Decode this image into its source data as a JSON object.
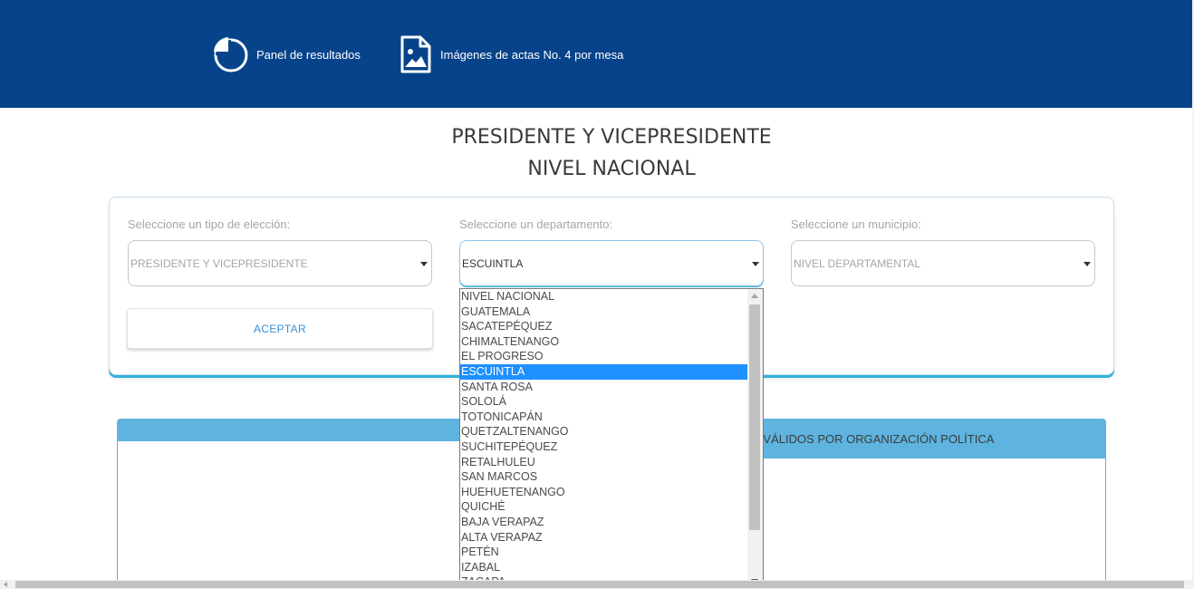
{
  "header": {
    "nav": [
      {
        "label": "Panel de resultados",
        "icon": "pie-chart-icon"
      },
      {
        "label": "Imágenes de actas No. 4 por mesa",
        "icon": "image-file-icon"
      }
    ],
    "background": "#06438a"
  },
  "titles": {
    "line1": "PRESIDENTE Y VICEPRESIDENTE",
    "line2": "NIVEL NACIONAL"
  },
  "filters": {
    "election": {
      "label": "Seleccione un tipo de elección:",
      "value": "PRESIDENTE Y VICEPRESIDENTE"
    },
    "department": {
      "label": "Seleccione un departamento:",
      "value": "ESCUINTLA"
    },
    "municipality": {
      "label": "Seleccione un municipio:",
      "value": "NIVEL DEPARTAMENTAL"
    },
    "accept_label": "ACEPTAR"
  },
  "results": {
    "title": "OS VÁLIDOS POR ORGANIZACIÓN POLÍTICA",
    "header_color": "#5eb4df"
  },
  "dropdown": {
    "selected": "ESCUINTLA",
    "options": [
      "NIVEL NACIONAL",
      "GUATEMALA",
      "SACATEPÉQUEZ",
      "CHIMALTENANGO",
      "EL PROGRESO",
      "ESCUINTLA",
      "SANTA ROSA",
      "SOLOLÁ",
      "TOTONICAPÁN",
      "QUETZALTENANGO",
      "SUCHITEPÉQUEZ",
      "RETALHULEU",
      "SAN MARCOS",
      "HUEHUETENANGO",
      "QUICHÉ",
      "BAJA VERAPAZ",
      "ALTA VERAPAZ",
      "PETÉN",
      "IZABAL",
      "ZACAPA"
    ]
  },
  "colors": {
    "accent": "#2fb2d9",
    "link": "#3b8fd9",
    "selection": "#1e90ff"
  }
}
